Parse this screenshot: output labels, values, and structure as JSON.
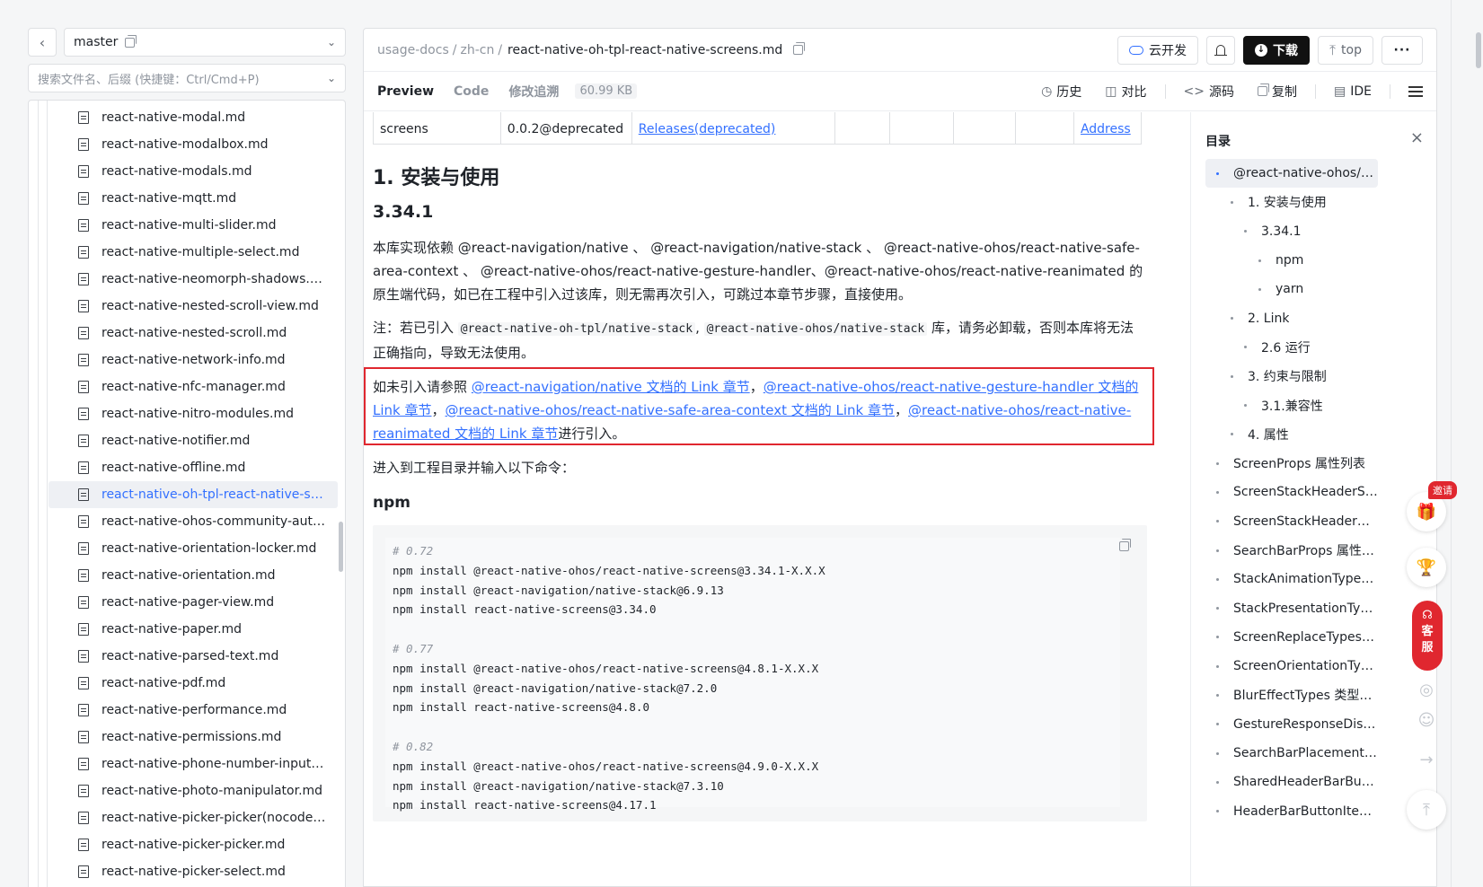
{
  "sidebar": {
    "branch": "master",
    "search_placeholder": "搜索文件名、后缀 (快捷键：Ctrl/Cmd+P)",
    "files": [
      "react-native-modal.md",
      "react-native-modalbox.md",
      "react-native-modals.md",
      "react-native-mqtt.md",
      "react-native-multi-slider.md",
      "react-native-multiple-select.md",
      "react-native-neomorph-shadows.md",
      "react-native-nested-scroll-view.md",
      "react-native-nested-scroll.md",
      "react-native-network-info.md",
      "react-native-nfc-manager.md",
      "react-native-nitro-modules.md",
      "react-native-notifier.md",
      "react-native-offline.md",
      "react-native-oh-tpl-react-native-screens.md",
      "react-native-ohos-community-auto-…",
      "react-native-orientation-locker.md",
      "react-native-orientation.md",
      "react-native-pager-view.md",
      "react-native-paper.md",
      "react-native-parsed-text.md",
      "react-native-pdf.md",
      "react-native-performance.md",
      "react-native-permissions.md",
      "react-native-phone-number-input.md",
      "react-native-photo-manipulator.md",
      "react-native-picker-picker(nocodege…",
      "react-native-picker-picker.md",
      "react-native-picker-select.md"
    ],
    "active_index": 14
  },
  "topbar": {
    "crumb1": "usage-docs",
    "crumb2": "zh-cn",
    "current": "react-native-oh-tpl-react-native-screens.md",
    "cloud_dev": "云开发",
    "download": "下载",
    "top": "top",
    "more": "···"
  },
  "tabsbar": {
    "tabs": [
      "Preview",
      "Code",
      "修改追溯"
    ],
    "size": "60.99 KB",
    "history": "历史",
    "compare": "对比",
    "source": "源码",
    "copy": "复制",
    "ide": "IDE"
  },
  "content": {
    "table_row": [
      "screens",
      "0.0.2@deprecated",
      "Releases(deprecated)",
      "",
      "",
      "",
      "",
      "",
      "Address"
    ],
    "h1": "1. 安装与使用",
    "h2": "3.34.1",
    "p1": "本库实现依赖 @react-navigation/native 、 @react-navigation/native-stack 、 @react-native-ohos/react-native-safe-area-context 、 @react-native-ohos/react-native-gesture-handler、@react-native-ohos/react-native-reanimated 的原生端代码，如已在工程中引入过该库，则无需再次引入，可跳过本章节步骤，直接使用。",
    "p2_pre": "注：若已引入 ",
    "p2_code1": "@react-native-oh-tpl/native-stack",
    "p2_code2": "@react-native-ohos/native-stack",
    "p2_post": " 库，请务必卸载，否则本库将无法正确指向，导致无法使用。",
    "p3_pre": "如未引入请参照 ",
    "p3_link1": "@react-navigation/native 文档的 Link 章节",
    "p3_link2": "@react-native-ohos/react-native-gesture-handler 文档的 Link 章节",
    "p3_link3": "@react-native-ohos/react-native-safe-area-context 文档的 Link 章节",
    "p3_link4": "@react-native-ohos/react-native-reanimated 文档的 Link 章节",
    "p3_post": "进行引入。",
    "p4": "进入到工程目录并输入以下命令：",
    "h3": "npm",
    "code_lines": [
      {
        "t": "# 0.72",
        "c": true
      },
      {
        "t": "npm install @react-native-ohos/react-native-screens@3.34.1-X.X.X",
        "c": false
      },
      {
        "t": "npm install @react-navigation/native-stack@6.9.13",
        "c": false
      },
      {
        "t": "npm install react-native-screens@3.34.0",
        "c": false
      },
      {
        "t": "",
        "c": false
      },
      {
        "t": "# 0.77",
        "c": true
      },
      {
        "t": "npm install @react-native-ohos/react-native-screens@4.8.1-X.X.X",
        "c": false
      },
      {
        "t": "npm install @react-navigation/native-stack@7.2.0",
        "c": false
      },
      {
        "t": "npm install react-native-screens@4.8.0",
        "c": false
      },
      {
        "t": "",
        "c": false
      },
      {
        "t": "# 0.82",
        "c": true
      },
      {
        "t": "npm install @react-native-ohos/react-native-screens@4.9.0-X.X.X",
        "c": false
      },
      {
        "t": "npm install @react-navigation/native-stack@7.3.10",
        "c": false
      },
      {
        "t": "npm install react-native-screens@4.17.1",
        "c": false
      }
    ]
  },
  "toc": {
    "title": "目录",
    "items": [
      {
        "label": "@react-native-ohos/r…",
        "level": 0,
        "active": true
      },
      {
        "label": "1. 安装与使用",
        "level": 1
      },
      {
        "label": "3.34.1",
        "level": 2
      },
      {
        "label": "npm",
        "level": 3
      },
      {
        "label": "yarn",
        "level": 3
      },
      {
        "label": "2. Link",
        "level": 1
      },
      {
        "label": "2.6 运行",
        "level": 2
      },
      {
        "label": "3. 约束与限制",
        "level": 1
      },
      {
        "label": "3.1.兼容性",
        "level": 2
      },
      {
        "label": "4. 属性",
        "level": 1
      },
      {
        "label": "ScreenProps 属性列表",
        "level": 0
      },
      {
        "label": "ScreenStackHeaderS…",
        "level": 0
      },
      {
        "label": "ScreenStackHeaderC…",
        "level": 0
      },
      {
        "label": "SearchBarProps 属性…",
        "level": 0
      },
      {
        "label": "StackAnimationTypes…",
        "level": 0
      },
      {
        "label": "StackPresentationTyp…",
        "level": 0
      },
      {
        "label": "ScreenReplaceTypes…",
        "level": 0
      },
      {
        "label": "ScreenOrientationTyp…",
        "level": 0
      },
      {
        "label": "BlurEffectTypes 类型…",
        "level": 0
      },
      {
        "label": "GestureResponseDist…",
        "level": 0
      },
      {
        "label": "SearchBarPlacement…",
        "level": 0
      },
      {
        "label": "SharedHeaderBarButt…",
        "level": 0
      },
      {
        "label": "HeaderBarButtonIte…",
        "level": 0
      }
    ]
  },
  "float": {
    "invite": "邀请",
    "service": "客服"
  }
}
